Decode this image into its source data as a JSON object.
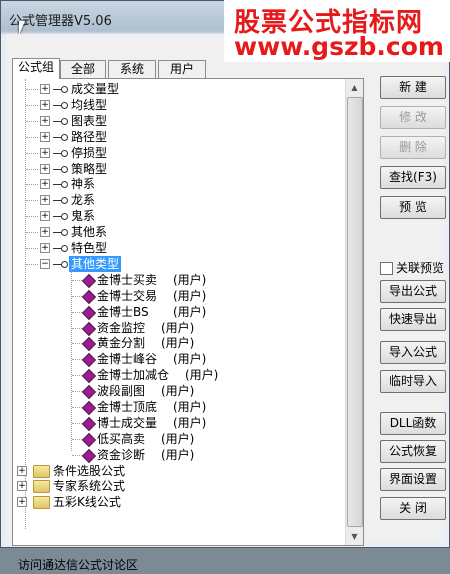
{
  "window": {
    "title": "公式管理器V5.06"
  },
  "watermark": {
    "line1": "股票公式指标网",
    "line2": "www.gszb.com"
  },
  "tabs": [
    "公式组",
    "全部",
    "系统",
    "用户"
  ],
  "tree": {
    "groups": [
      "成交量型",
      "均线型",
      "图表型",
      "路径型",
      "停损型",
      "策略型",
      "神系",
      "龙系",
      "鬼系",
      "其他系",
      "特色型"
    ],
    "selected_group": "其他类型",
    "children": [
      {
        "name": "金博士买卖",
        "tag": "(用户)"
      },
      {
        "name": "金博士交易",
        "tag": "(用户)"
      },
      {
        "name": "金博士BS",
        "tag": "(用户)"
      },
      {
        "name": "资金监控",
        "tag": "(用户)"
      },
      {
        "name": "黄金分割",
        "tag": "(用户)"
      },
      {
        "name": "金博士峰谷",
        "tag": "(用户)"
      },
      {
        "name": "金博士加减仓",
        "tag": "(用户)"
      },
      {
        "name": "波段副图",
        "tag": "(用户)"
      },
      {
        "name": "金博士顶底",
        "tag": "(用户)"
      },
      {
        "name": "博士成交量",
        "tag": "(用户)"
      },
      {
        "name": "低买高卖",
        "tag": "(用户)"
      },
      {
        "name": "资金诊断",
        "tag": "(用户)"
      }
    ],
    "folders": [
      "条件选股公式",
      "专家系统公式",
      "五彩K线公式"
    ]
  },
  "buttons": {
    "new": "新 建",
    "edit": "修 改",
    "delete": "删 除",
    "find": "查找(F3)",
    "preview": "预 览",
    "export": "导出公式",
    "quick_export": "快速导出",
    "import": "导入公式",
    "temp_import": "临时导入",
    "dll": "DLL函数",
    "restore": "公式恢复",
    "ui_settings": "界面设置",
    "close": "关 闭"
  },
  "checkbox": {
    "label": "关联预览",
    "checked": false
  },
  "status": {
    "text": "访问通达信公式讨论区"
  }
}
